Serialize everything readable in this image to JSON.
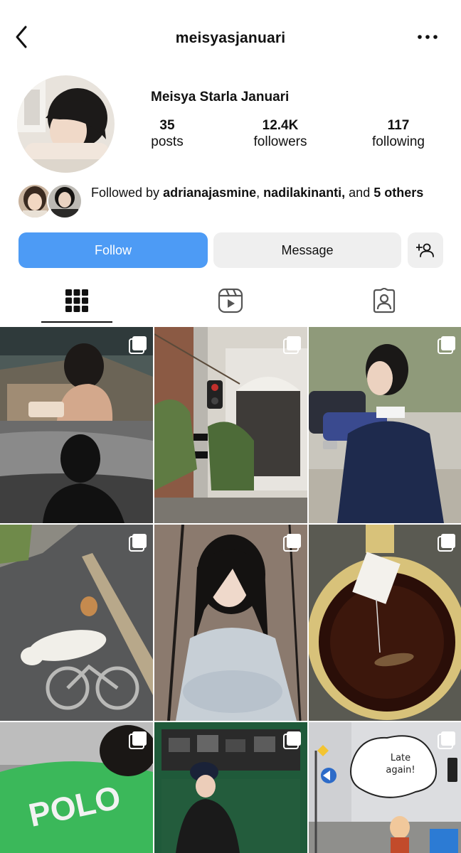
{
  "header": {
    "username": "meisyasjanuari",
    "back_icon": "chevron-left-icon",
    "more_icon": "more-horizontal-icon"
  },
  "profile": {
    "full_name": "Meisya Starla Januari",
    "stats": {
      "posts": {
        "value": "35",
        "label": "posts"
      },
      "followers": {
        "value": "12.4K",
        "label": "followers"
      },
      "following": {
        "value": "117",
        "label": "following"
      }
    },
    "followed_by": {
      "prefix": "Followed by ",
      "user1": "adrianajasmine",
      "sep1": ", ",
      "user2": "nadilakinanti,",
      "sep2": " and ",
      "others": "5 others"
    }
  },
  "actions": {
    "follow_label": "Follow",
    "message_label": "Message",
    "add_user_icon": "add-user-icon"
  },
  "tabs": [
    {
      "name": "posts-grid",
      "icon": "grid-icon",
      "active": true
    },
    {
      "name": "reels",
      "icon": "reels-icon",
      "active": false
    },
    {
      "name": "tagged",
      "icon": "tagged-user-icon",
      "active": false
    }
  ],
  "grid": {
    "posts": [
      {
        "description": "poolside",
        "multi": true
      },
      {
        "description": "street lamp",
        "multi": true
      },
      {
        "description": "girl with phone",
        "multi": true
      },
      {
        "description": "cat on asphalt",
        "multi": true
      },
      {
        "description": "portrait",
        "multi": true
      },
      {
        "description": "tea cup",
        "multi": true
      },
      {
        "description": "green sweatshirt",
        "multi": true
      },
      {
        "description": "camera shop",
        "multi": true
      },
      {
        "description": "street comic",
        "multi": true,
        "bubble_text_1": "Late",
        "bubble_text_2": "again!"
      }
    ]
  },
  "colors": {
    "follow_button": "#4d9bf5",
    "secondary_button": "#efefef",
    "text": "#111111"
  }
}
